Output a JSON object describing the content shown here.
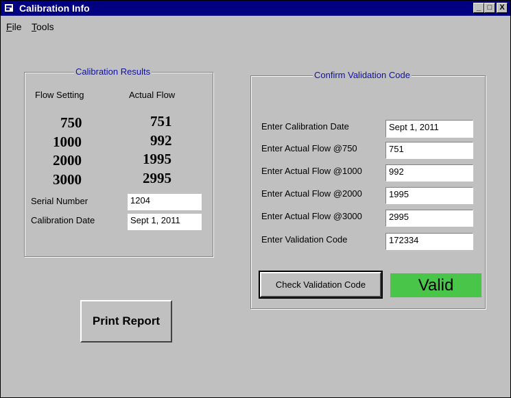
{
  "window": {
    "title": "Calibration Info",
    "controls": [
      "_",
      "□",
      "X"
    ]
  },
  "menu": {
    "items": [
      {
        "label": "File",
        "accel": "F",
        "rest": "ile"
      },
      {
        "label": "Tools",
        "accel": "T",
        "rest": "ools"
      }
    ]
  },
  "results": {
    "title": "Calibration Results",
    "col_flow_setting": "Flow Setting",
    "col_actual_flow": "Actual Flow",
    "rows": [
      {
        "setting": "750",
        "actual": "751"
      },
      {
        "setting": "1000",
        "actual": "992"
      },
      {
        "setting": "2000",
        "actual": "1995"
      },
      {
        "setting": "3000",
        "actual": "2995"
      }
    ],
    "serial_label": "Serial Number",
    "serial_value": "1204",
    "date_label": "Calibration Date",
    "date_value": "Sept 1, 2011"
  },
  "confirm": {
    "title": "Confirm Validation Code",
    "fields": [
      {
        "label": "Enter Calibration Date",
        "value": "Sept 1, 2011"
      },
      {
        "label": "Enter Actual Flow @750",
        "value": "751"
      },
      {
        "label": "Enter Actual Flow @1000",
        "value": "992"
      },
      {
        "label": "Enter Actual Flow @2000",
        "value": "1995"
      },
      {
        "label": "Enter Actual Flow @3000",
        "value": "2995"
      },
      {
        "label": "Enter Validation Code",
        "value": "172334"
      }
    ],
    "check_button": "Check Validation Code",
    "status": "Valid",
    "status_color": "#49c649"
  },
  "print_button": "Print Report",
  "colors": {
    "titlebar": "#000080",
    "background": "#c0c0c0",
    "group_title": "#1010a0"
  }
}
